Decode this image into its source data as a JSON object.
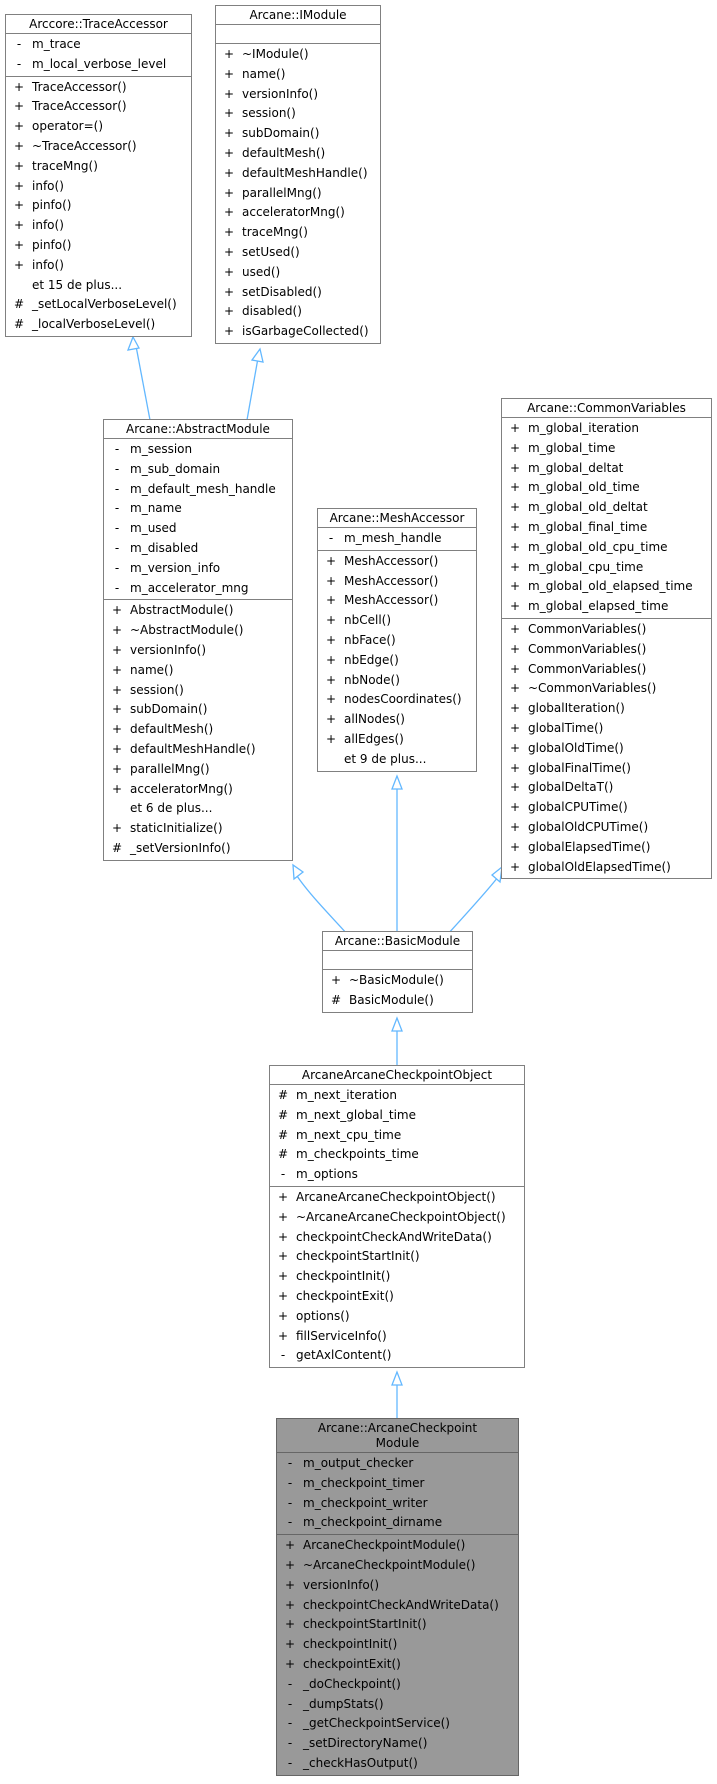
{
  "classes": {
    "trace_accessor": {
      "title": "Arccore::TraceAccessor",
      "attributes": [
        {
          "vis": "-",
          "name": "m_trace"
        },
        {
          "vis": "-",
          "name": "m_local_verbose_level"
        }
      ],
      "methods": [
        {
          "vis": "+",
          "name": "TraceAccessor()"
        },
        {
          "vis": "+",
          "name": "TraceAccessor()"
        },
        {
          "vis": "+",
          "name": "operator=()"
        },
        {
          "vis": "+",
          "name": "~TraceAccessor()"
        },
        {
          "vis": "+",
          "name": "traceMng()"
        },
        {
          "vis": "+",
          "name": "info()"
        },
        {
          "vis": "+",
          "name": "pinfo()"
        },
        {
          "vis": "+",
          "name": "info()"
        },
        {
          "vis": "+",
          "name": "pinfo()"
        },
        {
          "vis": "+",
          "name": "info()"
        },
        {
          "vis": "",
          "name": "et 15 de plus..."
        },
        {
          "vis": "#",
          "name": "_setLocalVerboseLevel()"
        },
        {
          "vis": "#",
          "name": "_localVerboseLevel()"
        }
      ]
    },
    "imodule": {
      "title": "Arcane::IModule",
      "attributes": [],
      "methods": [
        {
          "vis": "+",
          "name": "~IModule()"
        },
        {
          "vis": "+",
          "name": "name()"
        },
        {
          "vis": "+",
          "name": "versionInfo()"
        },
        {
          "vis": "+",
          "name": "session()"
        },
        {
          "vis": "+",
          "name": "subDomain()"
        },
        {
          "vis": "+",
          "name": "defaultMesh()"
        },
        {
          "vis": "+",
          "name": "defaultMeshHandle()"
        },
        {
          "vis": "+",
          "name": "parallelMng()"
        },
        {
          "vis": "+",
          "name": "acceleratorMng()"
        },
        {
          "vis": "+",
          "name": "traceMng()"
        },
        {
          "vis": "+",
          "name": "setUsed()"
        },
        {
          "vis": "+",
          "name": "used()"
        },
        {
          "vis": "+",
          "name": "setDisabled()"
        },
        {
          "vis": "+",
          "name": "disabled()"
        },
        {
          "vis": "+",
          "name": "isGarbageCollected()"
        }
      ]
    },
    "abstract_module": {
      "title": "Arcane::AbstractModule",
      "attributes": [
        {
          "vis": "-",
          "name": "m_session"
        },
        {
          "vis": "-",
          "name": "m_sub_domain"
        },
        {
          "vis": "-",
          "name": "m_default_mesh_handle"
        },
        {
          "vis": "-",
          "name": "m_name"
        },
        {
          "vis": "-",
          "name": "m_used"
        },
        {
          "vis": "-",
          "name": "m_disabled"
        },
        {
          "vis": "-",
          "name": "m_version_info"
        },
        {
          "vis": "-",
          "name": "m_accelerator_mng"
        }
      ],
      "methods": [
        {
          "vis": "+",
          "name": "AbstractModule()"
        },
        {
          "vis": "+",
          "name": "~AbstractModule()"
        },
        {
          "vis": "+",
          "name": "versionInfo()"
        },
        {
          "vis": "+",
          "name": "name()"
        },
        {
          "vis": "+",
          "name": "session()"
        },
        {
          "vis": "+",
          "name": "subDomain()"
        },
        {
          "vis": "+",
          "name": "defaultMesh()"
        },
        {
          "vis": "+",
          "name": "defaultMeshHandle()"
        },
        {
          "vis": "+",
          "name": "parallelMng()"
        },
        {
          "vis": "+",
          "name": "acceleratorMng()"
        },
        {
          "vis": "",
          "name": "et 6 de plus..."
        },
        {
          "vis": "+",
          "name": "staticInitialize()"
        },
        {
          "vis": "#",
          "name": "_setVersionInfo()"
        }
      ]
    },
    "mesh_accessor": {
      "title": "Arcane::MeshAccessor",
      "attributes": [
        {
          "vis": "-",
          "name": "m_mesh_handle"
        }
      ],
      "methods": [
        {
          "vis": "+",
          "name": "MeshAccessor()"
        },
        {
          "vis": "+",
          "name": "MeshAccessor()"
        },
        {
          "vis": "+",
          "name": "MeshAccessor()"
        },
        {
          "vis": "+",
          "name": "nbCell()"
        },
        {
          "vis": "+",
          "name": "nbFace()"
        },
        {
          "vis": "+",
          "name": "nbEdge()"
        },
        {
          "vis": "+",
          "name": "nbNode()"
        },
        {
          "vis": "+",
          "name": "nodesCoordinates()"
        },
        {
          "vis": "+",
          "name": "allNodes()"
        },
        {
          "vis": "+",
          "name": "allEdges()"
        },
        {
          "vis": "",
          "name": "et 9 de plus..."
        }
      ]
    },
    "common_variables": {
      "title": "Arcane::CommonVariables",
      "attributes": [
        {
          "vis": "+",
          "name": "m_global_iteration"
        },
        {
          "vis": "+",
          "name": "m_global_time"
        },
        {
          "vis": "+",
          "name": "m_global_deltat"
        },
        {
          "vis": "+",
          "name": "m_global_old_time"
        },
        {
          "vis": "+",
          "name": "m_global_old_deltat"
        },
        {
          "vis": "+",
          "name": "m_global_final_time"
        },
        {
          "vis": "+",
          "name": "m_global_old_cpu_time"
        },
        {
          "vis": "+",
          "name": "m_global_cpu_time"
        },
        {
          "vis": "+",
          "name": "m_global_old_elapsed_time"
        },
        {
          "vis": "+",
          "name": "m_global_elapsed_time"
        }
      ],
      "methods": [
        {
          "vis": "+",
          "name": "CommonVariables()"
        },
        {
          "vis": "+",
          "name": "CommonVariables()"
        },
        {
          "vis": "+",
          "name": "CommonVariables()"
        },
        {
          "vis": "+",
          "name": "~CommonVariables()"
        },
        {
          "vis": "+",
          "name": "globalIteration()"
        },
        {
          "vis": "+",
          "name": "globalTime()"
        },
        {
          "vis": "+",
          "name": "globalOldTime()"
        },
        {
          "vis": "+",
          "name": "globalFinalTime()"
        },
        {
          "vis": "+",
          "name": "globalDeltaT()"
        },
        {
          "vis": "+",
          "name": "globalCPUTime()"
        },
        {
          "vis": "+",
          "name": "globalOldCPUTime()"
        },
        {
          "vis": "+",
          "name": "globalElapsedTime()"
        },
        {
          "vis": "+",
          "name": "globalOldElapsedTime()"
        }
      ]
    },
    "basic_module": {
      "title": "Arcane::BasicModule",
      "attributes": [],
      "methods": [
        {
          "vis": "+",
          "name": "~BasicModule()"
        },
        {
          "vis": "#",
          "name": "BasicModule()"
        }
      ]
    },
    "checkpoint_object": {
      "title": "ArcaneArcaneCheckpointObject",
      "attributes": [
        {
          "vis": "#",
          "name": "m_next_iteration"
        },
        {
          "vis": "#",
          "name": "m_next_global_time"
        },
        {
          "vis": "#",
          "name": "m_next_cpu_time"
        },
        {
          "vis": "#",
          "name": "m_checkpoints_time"
        },
        {
          "vis": "-",
          "name": "m_options"
        }
      ],
      "methods": [
        {
          "vis": "+",
          "name": "ArcaneArcaneCheckpointObject()"
        },
        {
          "vis": "+",
          "name": "~ArcaneArcaneCheckpointObject()"
        },
        {
          "vis": "+",
          "name": "checkpointCheckAndWriteData()"
        },
        {
          "vis": "+",
          "name": "checkpointStartInit()"
        },
        {
          "vis": "+",
          "name": "checkpointInit()"
        },
        {
          "vis": "+",
          "name": "checkpointExit()"
        },
        {
          "vis": "+",
          "name": "options()"
        },
        {
          "vis": "+",
          "name": "fillServiceInfo()"
        },
        {
          "vis": "-",
          "name": "getAxlContent()"
        }
      ]
    },
    "checkpoint_module": {
      "title": "Arcane::ArcaneCheckpoint\nModule",
      "attributes": [
        {
          "vis": "-",
          "name": "m_output_checker"
        },
        {
          "vis": "-",
          "name": "m_checkpoint_timer"
        },
        {
          "vis": "-",
          "name": "m_checkpoint_writer"
        },
        {
          "vis": "-",
          "name": "m_checkpoint_dirname"
        }
      ],
      "methods": [
        {
          "vis": "+",
          "name": "ArcaneCheckpointModule()"
        },
        {
          "vis": "+",
          "name": "~ArcaneCheckpointModule()"
        },
        {
          "vis": "+",
          "name": "versionInfo()"
        },
        {
          "vis": "+",
          "name": "checkpointCheckAndWriteData()"
        },
        {
          "vis": "+",
          "name": "checkpointStartInit()"
        },
        {
          "vis": "+",
          "name": "checkpointInit()"
        },
        {
          "vis": "+",
          "name": "checkpointExit()"
        },
        {
          "vis": "-",
          "name": "_doCheckpoint()"
        },
        {
          "vis": "-",
          "name": "_dumpStats()"
        },
        {
          "vis": "-",
          "name": "_getCheckpointService()"
        },
        {
          "vis": "-",
          "name": "_setDirectoryName()"
        },
        {
          "vis": "-",
          "name": "_checkHasOutput()"
        }
      ]
    }
  },
  "colors": {
    "edge": "#63b8ff",
    "border": "#808080",
    "focus_fill": "#999999"
  }
}
